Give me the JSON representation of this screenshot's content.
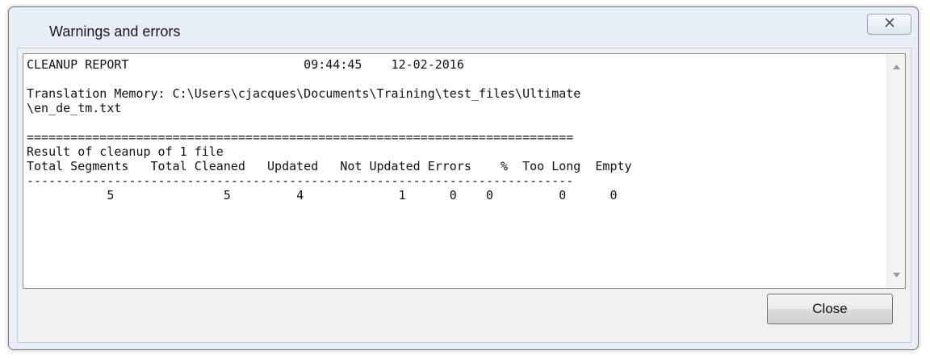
{
  "window": {
    "title": "Warnings and errors",
    "close_icon": "close-x-icon"
  },
  "report": {
    "lines": [
      "CLEANUP REPORT                        09:44:45    12-02-2016",
      "",
      "Translation Memory: C:\\Users\\cjacques\\Documents\\Training\\test_files\\Ultimate",
      "\\en_de_tm.txt",
      "",
      "===========================================================================",
      "Result of cleanup of 1 file",
      "Total Segments   Total Cleaned   Updated   Not Updated Errors    %  Too Long  Empty",
      "---------------------------------------------------------------------------",
      "           5               5         4             1      0    0         0      0"
    ],
    "title": "CLEANUP REPORT",
    "time": "09:44:45",
    "date": "12-02-2016",
    "tm_path": "C:\\Users\\cjacques\\Documents\\Training\\test_files\\Ultimate\\en_de_tm.txt",
    "summary": "Result of cleanup of 1 file",
    "columns": [
      "Total Segments",
      "Total Cleaned",
      "Updated",
      "Not Updated",
      "Errors",
      "%",
      "Too Long",
      "Empty"
    ],
    "values": [
      5,
      5,
      4,
      1,
      0,
      0,
      0,
      0
    ]
  },
  "buttons": {
    "close_label": "Close"
  },
  "colors": {
    "window_frame": "#e7eef6",
    "client_bg": "#f0f0f0",
    "text": "#111111"
  }
}
